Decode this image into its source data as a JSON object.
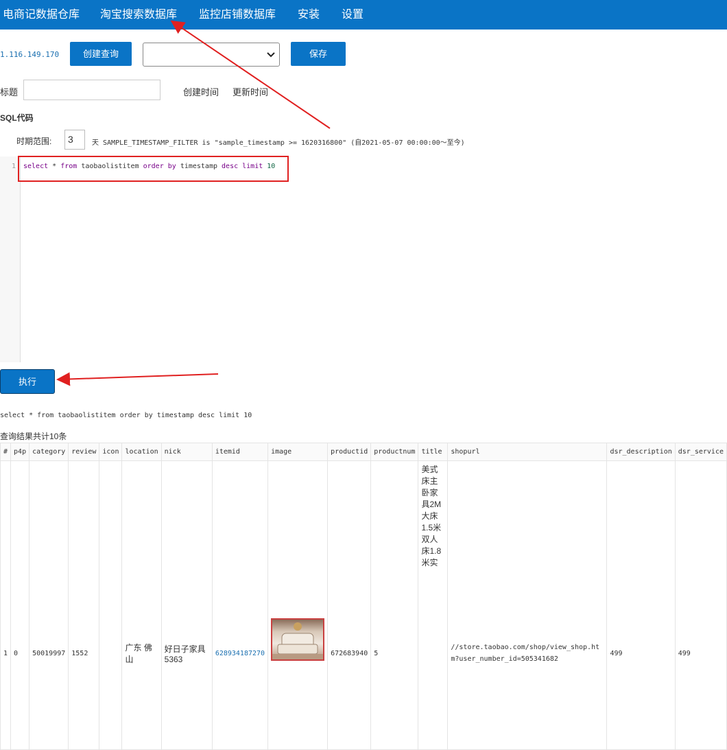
{
  "nav": {
    "items": [
      {
        "label": "电商记数据仓库"
      },
      {
        "label": "淘宝搜索数据库"
      },
      {
        "label": "监控店铺数据库"
      },
      {
        "label": "安装"
      },
      {
        "label": "设置"
      }
    ]
  },
  "toolbar": {
    "ip": "1.116.149.170",
    "create_query_label": "创建查询",
    "select_value": "",
    "save_label": "保存"
  },
  "meta": {
    "title_label": "标题",
    "title_value": "",
    "created_label": "创建时间",
    "updated_label": "更新时间"
  },
  "sql": {
    "heading": "SQL代码",
    "range_label": "时期范围:",
    "range_value": "3",
    "range_suffix": "天 SAMPLE_TIMESTAMP_FILTER is \"sample_timestamp >= 1620316800\" (自2021-05-07 00:00:00～至今)",
    "line_number": "1",
    "code_tokens": [
      {
        "text": "select ",
        "cls": "kw"
      },
      {
        "text": "* ",
        "cls": ""
      },
      {
        "text": "from ",
        "cls": "kw"
      },
      {
        "text": "taobaolistitem ",
        "cls": ""
      },
      {
        "text": "order ",
        "cls": "kw"
      },
      {
        "text": "by ",
        "cls": "kw"
      },
      {
        "text": "timestamp ",
        "cls": ""
      },
      {
        "text": "desc ",
        "cls": "kw"
      },
      {
        "text": "limit ",
        "cls": "kw"
      },
      {
        "text": "10",
        "cls": "num"
      }
    ]
  },
  "execute_label": "执行",
  "executed_sql": "select * from taobaolistitem order by timestamp desc limit 10",
  "result_count": "查询结果共计10条",
  "table": {
    "columns": [
      "#",
      "p4p",
      "category",
      "review",
      "icon",
      "location",
      "nick",
      "itemid",
      "image",
      "productid",
      "productnum",
      "title",
      "shopurl",
      "dsr_description",
      "dsr_service"
    ],
    "row": {
      "index": "1",
      "p4p": "0",
      "category": "50019997",
      "review": "1552",
      "icon": "",
      "location": "广东 佛山",
      "nick": "好日子家具5363",
      "itemid": "628934187270",
      "productid": "672683940",
      "productnum": "5",
      "title": "美式床主卧家具2M大床1.5米双人床1.8米实",
      "shopurl": "//store.taobao.com/shop/view_shop.htm?user_number_id=505341682",
      "dsr_description": "499",
      "dsr_service": "499"
    }
  },
  "colors": {
    "accent": "#0a74c6",
    "annotation": "#e02020"
  }
}
